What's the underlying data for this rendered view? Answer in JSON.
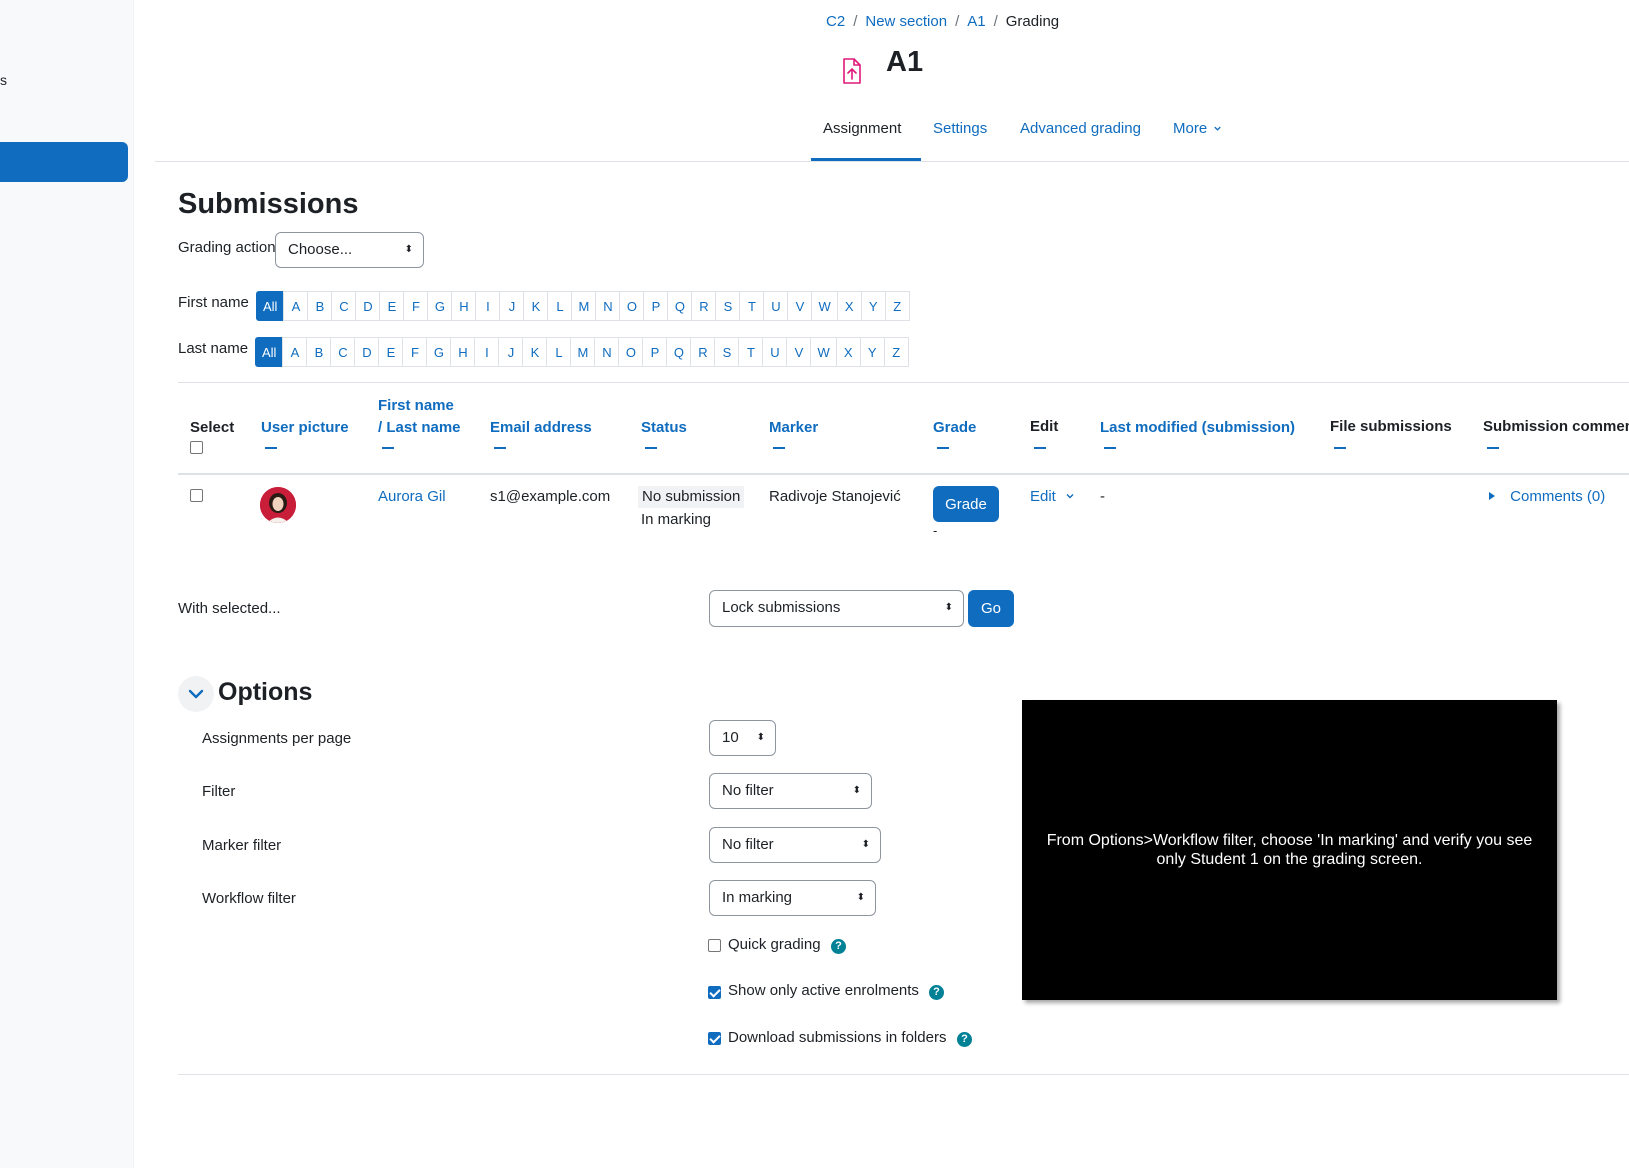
{
  "drawer": {
    "stub_text": "s"
  },
  "breadcrumb": {
    "items": [
      "C2",
      "New section",
      "A1"
    ],
    "current": "Grading",
    "separator": "/"
  },
  "page": {
    "title": "A1",
    "icon": "assignment-upload-icon"
  },
  "secondary_nav": {
    "tabs": [
      "Assignment",
      "Settings",
      "Advanced grading",
      "More"
    ],
    "active": "Assignment"
  },
  "submissions": {
    "heading": "Submissions",
    "grading_action_label": "Grading action",
    "grading_action_value": "Choose..."
  },
  "initials_filter": {
    "first_name_label": "First name",
    "last_name_label": "Last name",
    "letters": [
      "All",
      "A",
      "B",
      "C",
      "D",
      "E",
      "F",
      "G",
      "H",
      "I",
      "J",
      "K",
      "L",
      "M",
      "N",
      "O",
      "P",
      "Q",
      "R",
      "S",
      "T",
      "U",
      "V",
      "W",
      "X",
      "Y",
      "Z"
    ]
  },
  "table": {
    "headers": {
      "select": "Select",
      "user_picture": "User picture",
      "first_name": "First name",
      "last_name": "/ Last name",
      "email": "Email address",
      "status": "Status",
      "marker": "Marker",
      "grade": "Grade",
      "edit": "Edit",
      "last_modified": "Last modified (submission)",
      "file_submissions": "File submissions",
      "submission_comments": "Submission comments"
    },
    "rows": [
      {
        "name": "Aurora Gil",
        "email": "s1@example.com",
        "status": "No submission",
        "workflow": "In marking",
        "marker": "Radivoje Stanojević",
        "grade_button": "Grade",
        "grade_value": "-",
        "edit": "Edit",
        "last_modified": "-",
        "comments": "Comments (0)"
      }
    ]
  },
  "bulk": {
    "label": "With selected...",
    "action": "Lock submissions",
    "go": "Go"
  },
  "options": {
    "heading": "Options",
    "assignments_per_page_label": "Assignments per page",
    "assignments_per_page_value": "10",
    "filter_label": "Filter",
    "filter_value": "No filter",
    "marker_filter_label": "Marker filter",
    "marker_filter_value": "No filter",
    "workflow_filter_label": "Workflow filter",
    "workflow_filter_value": "In marking",
    "quick_grading": "Quick grading",
    "quick_grading_checked": false,
    "show_active": "Show only active enrolments",
    "show_active_checked": true,
    "download_folders": "Download submissions in folders",
    "download_folders_checked": true,
    "help_glyph": "?"
  },
  "overlay": {
    "text": "From Options>Workflow filter, choose 'In marking' and verify you see only Student 1 on the grading screen."
  },
  "colors": {
    "primary": "#0f6cbf",
    "help": "#008196",
    "icon_pink": "#e0197a"
  }
}
